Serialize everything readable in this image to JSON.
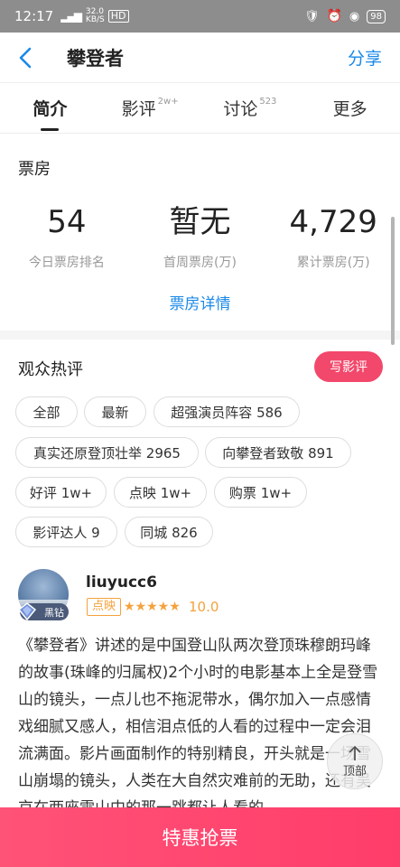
{
  "status_bar": {
    "time": "12:17",
    "net_top": "32.0",
    "net_bottom": "KB/S",
    "hd": "HD",
    "battery": "98"
  },
  "nav": {
    "title": "攀登者",
    "share_label": "分享"
  },
  "tabs": [
    {
      "label": "简介",
      "count": ""
    },
    {
      "label": "影评",
      "count": "2w+"
    },
    {
      "label": "讨论",
      "count": "523"
    },
    {
      "label": "更多",
      "count": ""
    }
  ],
  "box_office": {
    "title": "票房",
    "stats": [
      {
        "value": "54",
        "label": "今日票房排名"
      },
      {
        "value": "暂无",
        "label": "首周票房(万)"
      },
      {
        "value": "4,729",
        "label": "累计票房(万)"
      }
    ],
    "detail_link": "票房详情"
  },
  "reviews": {
    "title": "观众热评",
    "write_label": "写影评",
    "tags": [
      "全部",
      "最新",
      "超强演员阵容 586",
      "真实还原登顶壮举 2965",
      "向攀登者致敬 891",
      "好评 1w+",
      "点映 1w+",
      "购票 1w+",
      "影评达人 9",
      "同城 826"
    ],
    "item": {
      "username": "liuyucc6",
      "vip_label": "黑钻",
      "type_badge": "点映",
      "stars": "★★★★★",
      "score": "10.0",
      "text": "《攀登者》讲述的是中国登山队两次登顶珠穆朗玛峰的故事(珠峰的归属权)2个小时的电影基本上全是登雪山的镜头，一点儿也不拖泥带水，偶尔加入一点感情戏细腻又感人，相信泪点低的人看的过程中一定会泪流满面。影片画面制作的特别精良，开头就是一场雪山崩塌的镜头，人类在大自然灾难前的无助，还有吴京在两座雪山中的那一跳都让人看的..."
    }
  },
  "to_top_label": "顶部",
  "buy_label": "特惠抢票",
  "colors": {
    "accent_blue": "#1a89e8",
    "accent_pink": "#f2486b",
    "star_orange": "#f4a23b"
  }
}
